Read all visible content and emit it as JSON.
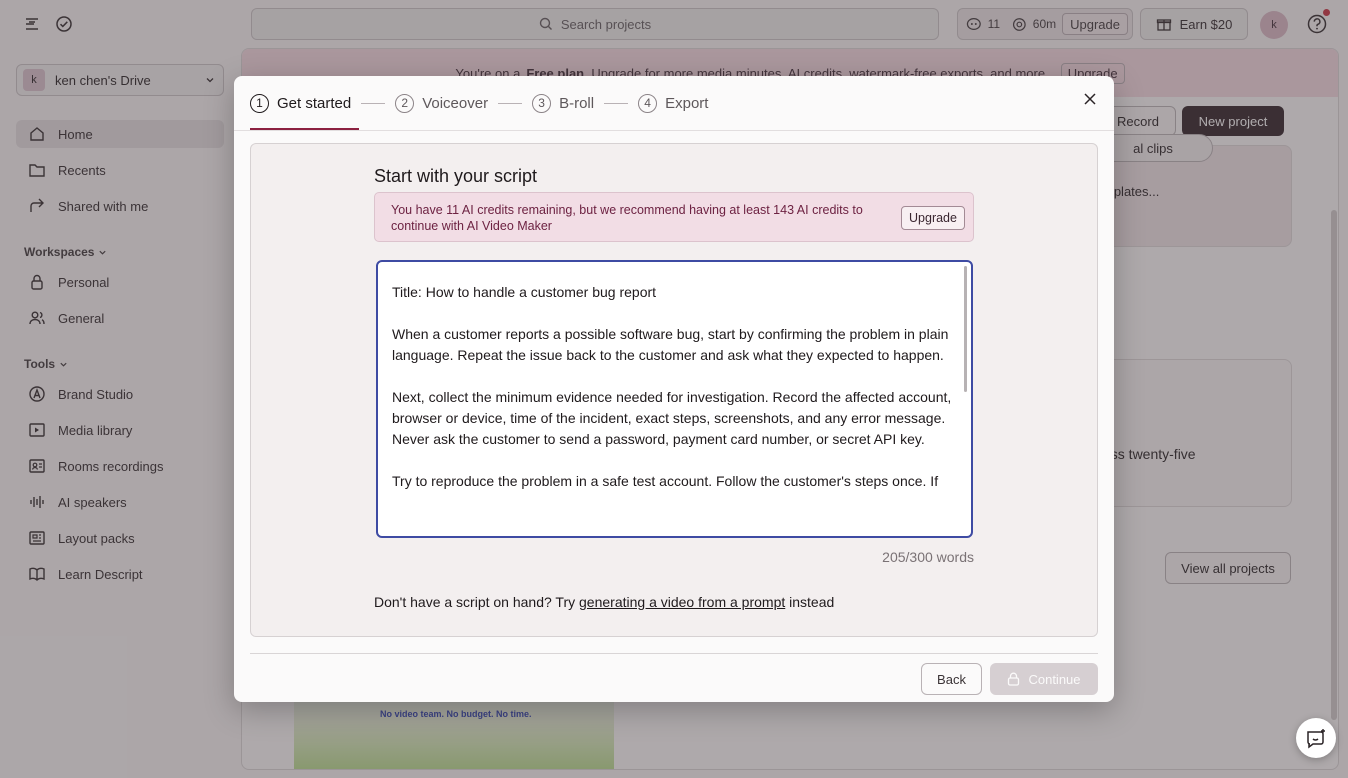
{
  "topbar": {
    "search_placeholder": "Search projects",
    "credits_count": "11",
    "minutes": "60m",
    "upgrade_label": "Upgrade",
    "earn_label": "Earn $20",
    "avatar_initial": "k"
  },
  "sidebar": {
    "drive_initial": "k",
    "drive_name": "ken chen's Drive",
    "items": [
      {
        "label": "Home",
        "icon": "home-icon",
        "active": true
      },
      {
        "label": "Recents",
        "icon": "folder-icon"
      },
      {
        "label": "Shared with me",
        "icon": "share-icon"
      }
    ],
    "workspaces_label": "Workspaces",
    "workspaces": [
      {
        "label": "Personal",
        "icon": "lock-icon"
      },
      {
        "label": "General",
        "icon": "users-icon"
      }
    ],
    "tools_label": "Tools",
    "tools": [
      {
        "label": "Brand Studio",
        "icon": "brand-icon"
      },
      {
        "label": "Media library",
        "icon": "media-icon"
      },
      {
        "label": "Rooms recordings",
        "icon": "rooms-icon"
      },
      {
        "label": "AI speakers",
        "icon": "waveform-icon"
      },
      {
        "label": "Layout packs",
        "icon": "layout-icon"
      },
      {
        "label": "Learn Descript",
        "icon": "book-icon"
      }
    ]
  },
  "background": {
    "banner_prefix": "You're on a",
    "banner_plan": "Free plan",
    "banner_suffix": ". Upgrade for more media minutes, AI credits, watermark-free exports, and more.",
    "banner_upgrade": "Upgrade",
    "record_label": "Record",
    "new_project_label": "New project",
    "clips_fragment": "al clips",
    "templates_fragment": "mplates...",
    "card_fragment": "oss twenty-five",
    "view_all_label": "View all projects",
    "thumb_caption": "No video team. No budget. No time."
  },
  "modal": {
    "steps": [
      {
        "num": "1",
        "label": "Get started",
        "active": true
      },
      {
        "num": "2",
        "label": "Voiceover"
      },
      {
        "num": "3",
        "label": "B-roll"
      },
      {
        "num": "4",
        "label": "Export"
      }
    ],
    "title": "Start with your script",
    "warning_text": "You have 11 AI credits remaining, but we recommend having at least 143 AI credits to continue with AI Video Maker",
    "warning_upgrade": "Upgrade",
    "script_paragraphs": [
      "Title: How to handle a customer bug report",
      "When a customer reports a possible software bug, start by confirming the problem in plain language. Repeat the issue back to the customer and ask what they expected to happen.",
      "Next, collect the minimum evidence needed for investigation. Record the affected account, browser or device, time of the incident, exact steps, screenshots, and any error message. Never ask the customer to send a password, payment card number, or secret API key.",
      "Try to reproduce the problem in a safe test account. Follow the customer's steps once. If"
    ],
    "word_count": "205/300 words",
    "prompt_prefix": "Don't have a script on hand? Try",
    "prompt_link": "generating a video from a prompt",
    "prompt_suffix": "instead",
    "back_label": "Back",
    "continue_label": "Continue"
  }
}
